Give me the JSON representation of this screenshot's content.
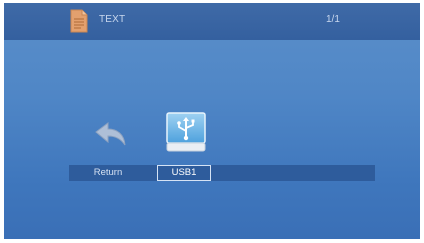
{
  "header": {
    "title": "TEXT",
    "page_indicator": "1/1",
    "icon": "document-icon"
  },
  "items": [
    {
      "label": "Return",
      "icon": "return-arrow-icon",
      "selected": false
    },
    {
      "label": "USB1",
      "icon": "usb-drive-icon",
      "selected": true
    }
  ],
  "colors": {
    "background": "#4f86c6",
    "header": "#3f6aa7",
    "label_bar": "#2e5c9c",
    "document_icon": "#e3a06e"
  }
}
